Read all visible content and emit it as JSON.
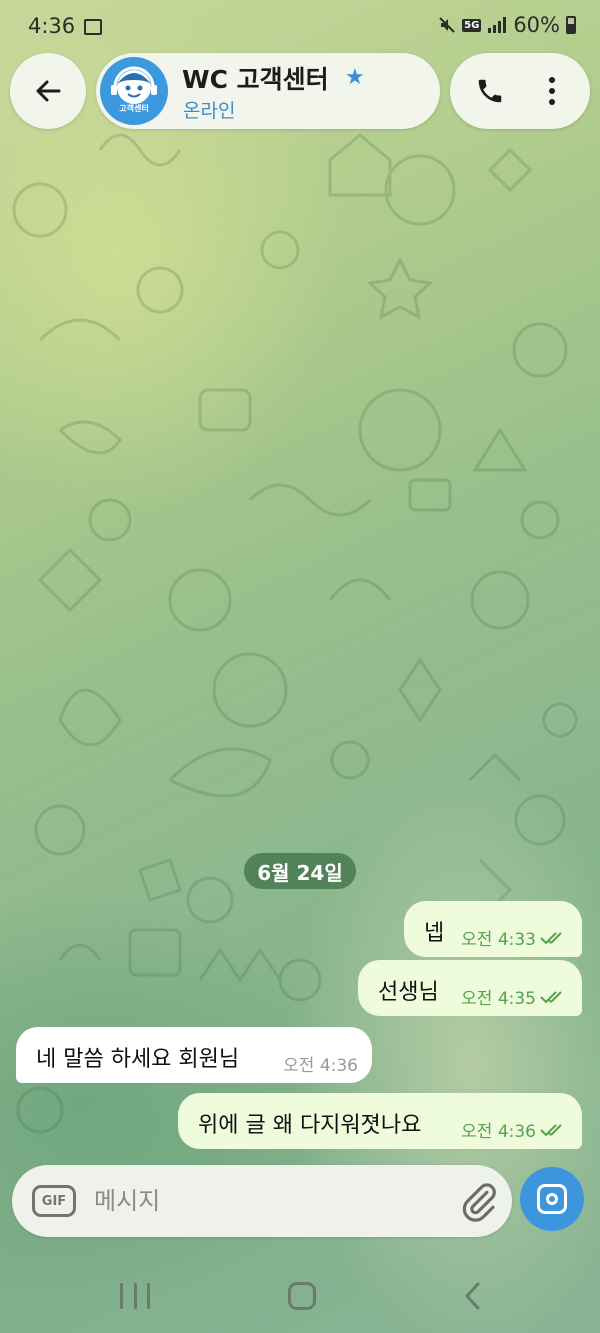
{
  "status_bar": {
    "time": "4:36",
    "network": "5G",
    "battery": "60%"
  },
  "header": {
    "title": "WC 고객센터",
    "status": "온라인",
    "avatar_text": "고객센터"
  },
  "date_chip": "6월 24일",
  "messages": [
    {
      "direction": "out",
      "text": "넵",
      "time": "오전 4:33",
      "read": true
    },
    {
      "direction": "out",
      "text": "선생님",
      "time": "오전 4:35",
      "read": true
    },
    {
      "direction": "in",
      "text": "네 말씀 하세요 회원님",
      "time": "오전 4:36"
    },
    {
      "direction": "out",
      "text": "위에 글 왜 다지워졋나요",
      "time": "오전 4:36",
      "read": true
    }
  ],
  "composer": {
    "gif_label": "GIF",
    "placeholder": "메시지"
  },
  "colors": {
    "accent": "#3d95de",
    "outgoing_bubble": "#eefcdc",
    "read_ticks": "#56a24d",
    "date_chip": "#467850"
  },
  "icons": [
    "back-arrow-icon",
    "star-icon",
    "phone-icon",
    "more-vertical-icon",
    "gif-icon",
    "paperclip-icon",
    "camera-icon",
    "double-check-icon"
  ]
}
